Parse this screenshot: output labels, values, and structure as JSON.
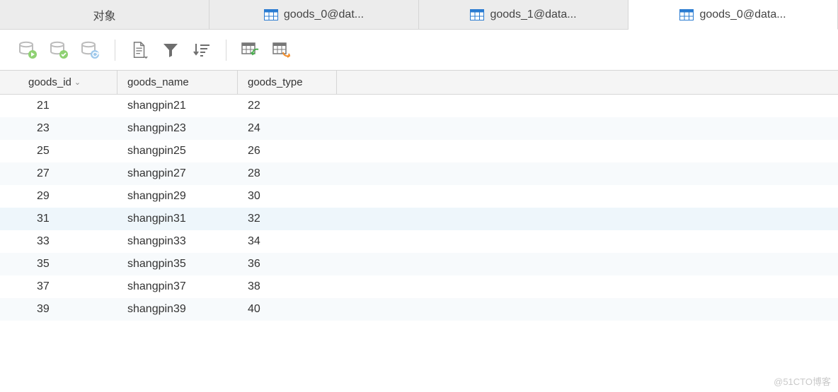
{
  "tabs": [
    {
      "label": "对象",
      "icon": null
    },
    {
      "label": "goods_0@dat...",
      "icon": "table"
    },
    {
      "label": "goods_1@data...",
      "icon": "table"
    },
    {
      "label": "goods_0@data...",
      "icon": "table",
      "active": true
    }
  ],
  "columns": [
    {
      "name": "goods_id",
      "sorted": true
    },
    {
      "name": "goods_name"
    },
    {
      "name": "goods_type"
    }
  ],
  "rows": [
    {
      "goods_id": "21",
      "goods_name": "shangpin21",
      "goods_type": "22"
    },
    {
      "goods_id": "23",
      "goods_name": "shangpin23",
      "goods_type": "24"
    },
    {
      "goods_id": "25",
      "goods_name": "shangpin25",
      "goods_type": "26"
    },
    {
      "goods_id": "27",
      "goods_name": "shangpin27",
      "goods_type": "28"
    },
    {
      "goods_id": "29",
      "goods_name": "shangpin29",
      "goods_type": "30"
    },
    {
      "goods_id": "31",
      "goods_name": "shangpin31",
      "goods_type": "32"
    },
    {
      "goods_id": "33",
      "goods_name": "shangpin33",
      "goods_type": "34"
    },
    {
      "goods_id": "35",
      "goods_name": "shangpin35",
      "goods_type": "36"
    },
    {
      "goods_id": "37",
      "goods_name": "shangpin37",
      "goods_type": "38"
    },
    {
      "goods_id": "39",
      "goods_name": "shangpin39",
      "goods_type": "40"
    }
  ],
  "highlight_row_index": 5,
  "watermark": "@51CTO博客"
}
